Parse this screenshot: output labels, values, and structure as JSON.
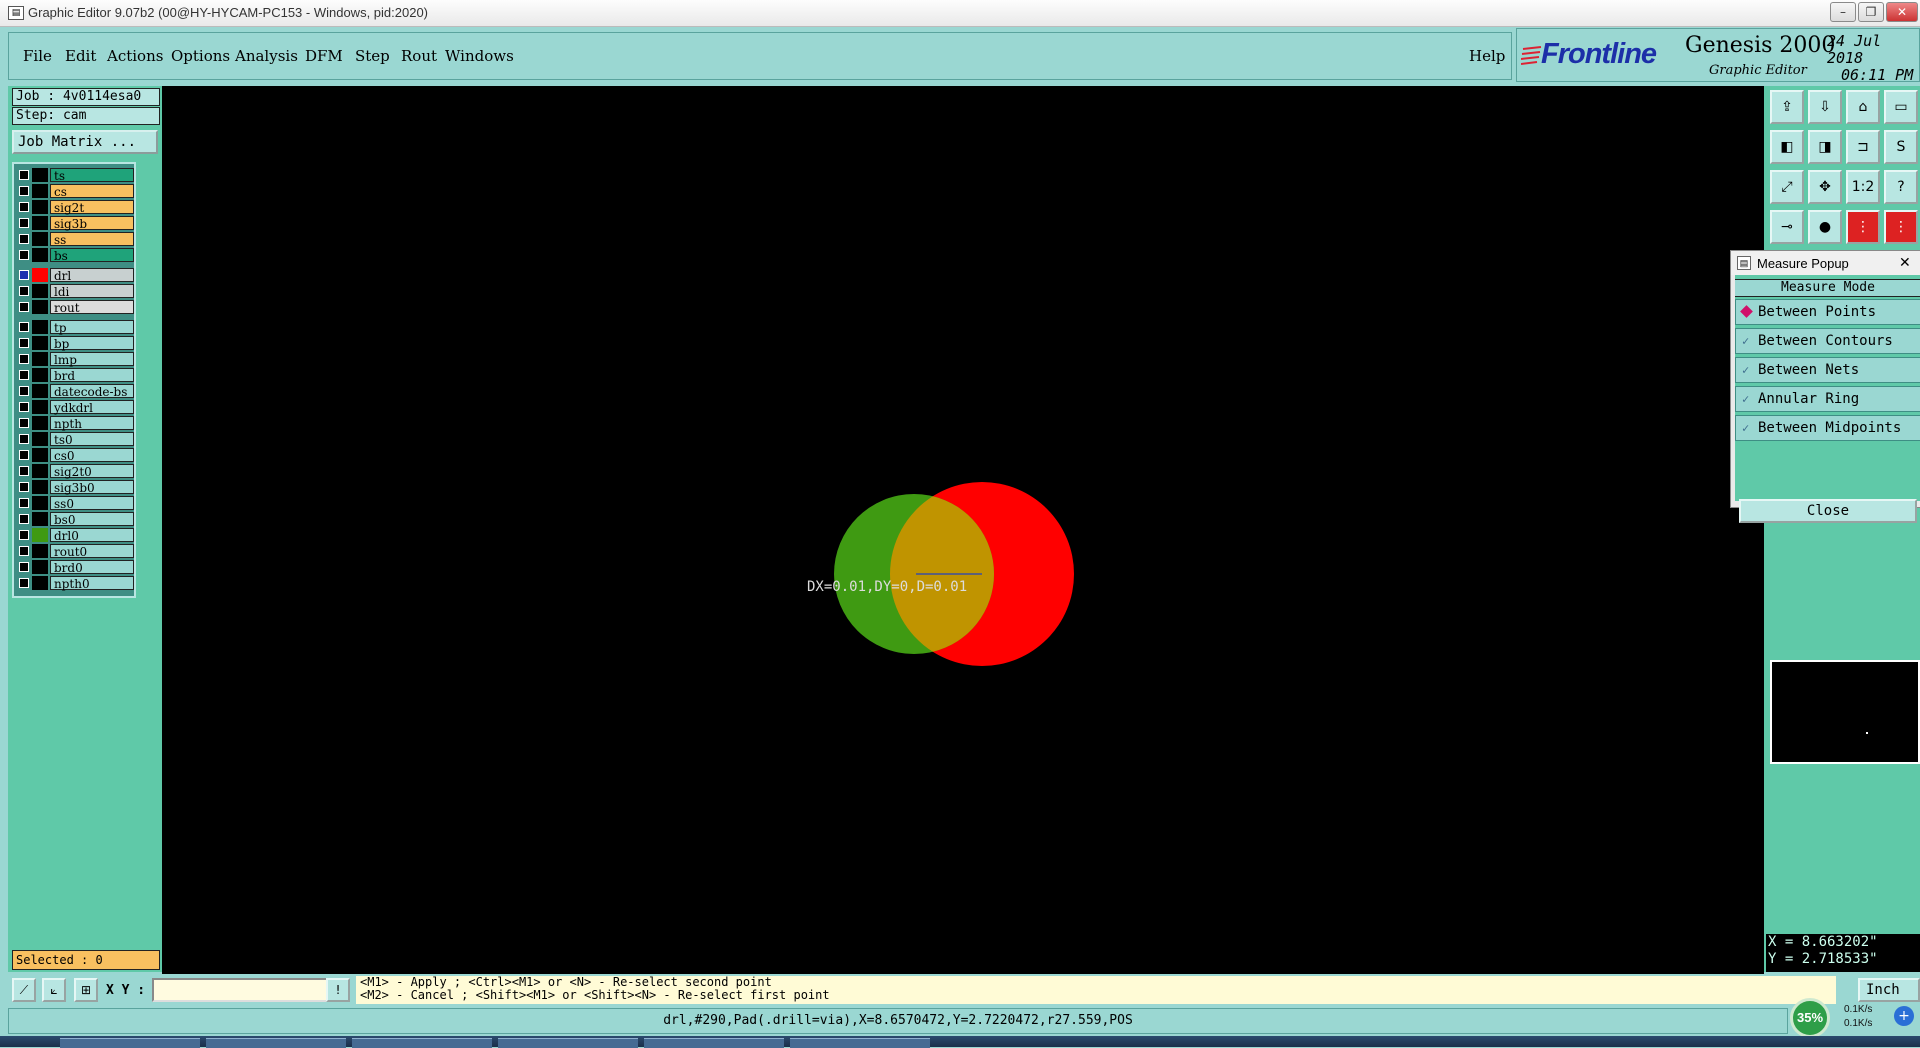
{
  "window": {
    "title": "Graphic Editor 9.07b2 (00@HY-HYCAM-PC153 - Windows, pid:2020)",
    "controls": [
      "–",
      "❐",
      "✕"
    ]
  },
  "menu": {
    "items": [
      {
        "label": "File",
        "name": "menu-file"
      },
      {
        "label": "Edit",
        "name": "menu-edit"
      },
      {
        "label": "Actions",
        "name": "menu-actions"
      },
      {
        "label": "Options",
        "name": "menu-options"
      },
      {
        "label": "Analysis",
        "name": "menu-analysis"
      },
      {
        "label": "DFM",
        "name": "menu-dfm"
      },
      {
        "label": "Step",
        "name": "menu-step"
      },
      {
        "label": "Rout",
        "name": "menu-rout"
      },
      {
        "label": "Windows",
        "name": "menu-windows"
      }
    ],
    "help": "Help"
  },
  "brand": {
    "logo": "Frontline",
    "product": "Genesis 2000",
    "subtitle": "Graphic Editor",
    "date": "24 Jul 2018",
    "time": "06:11 PM"
  },
  "job": {
    "job_label": "Job : 4v0114esa0",
    "step_label": "Step: cam",
    "matrix_button": "Job Matrix ..."
  },
  "layers": [
    {
      "name": "ts",
      "color": "#1fa37a",
      "swatch": "#000",
      "group": 0
    },
    {
      "name": "cs",
      "color": "#f8c060",
      "swatch": "#000",
      "group": 0
    },
    {
      "name": "sig2t",
      "color": "#f8c060",
      "swatch": "#000",
      "group": 0
    },
    {
      "name": "sig3b",
      "color": "#f8c060",
      "swatch": "#000",
      "group": 0
    },
    {
      "name": "ss",
      "color": "#f8c060",
      "swatch": "#000",
      "group": 0
    },
    {
      "name": "bs",
      "color": "#1fa37a",
      "swatch": "#000",
      "group": 0
    },
    {
      "name": "drl",
      "color": "#c8d0d0",
      "swatch": "#ff0000",
      "group": 1,
      "active": true
    },
    {
      "name": "ldi",
      "color": "#c8d0d0",
      "swatch": "#000",
      "group": 1
    },
    {
      "name": "rout",
      "color": "#dcdcdc",
      "swatch": "#000",
      "group": 1
    },
    {
      "name": "tp",
      "color": "#9ad7d2",
      "swatch": "#000",
      "group": 2
    },
    {
      "name": "bp",
      "color": "#9ad7d2",
      "swatch": "#000",
      "group": 2
    },
    {
      "name": "lmp",
      "color": "#9ad7d2",
      "swatch": "#000",
      "group": 2
    },
    {
      "name": "brd",
      "color": "#9ad7d2",
      "swatch": "#000",
      "group": 2
    },
    {
      "name": "datecode-bs",
      "color": "#9ad7d2",
      "swatch": "#000",
      "group": 2
    },
    {
      "name": "ydkdrl",
      "color": "#9ad7d2",
      "swatch": "#000",
      "group": 2
    },
    {
      "name": "npth",
      "color": "#9ad7d2",
      "swatch": "#000",
      "group": 2
    },
    {
      "name": "ts0",
      "color": "#9ad7d2",
      "swatch": "#000",
      "group": 2
    },
    {
      "name": "cs0",
      "color": "#9ad7d2",
      "swatch": "#000",
      "group": 2
    },
    {
      "name": "sig2t0",
      "color": "#9ad7d2",
      "swatch": "#000",
      "group": 2
    },
    {
      "name": "sig3b0",
      "color": "#9ad7d2",
      "swatch": "#000",
      "group": 2
    },
    {
      "name": "ss0",
      "color": "#9ad7d2",
      "swatch": "#000",
      "group": 2
    },
    {
      "name": "bs0",
      "color": "#9ad7d2",
      "swatch": "#000",
      "group": 2
    },
    {
      "name": "drl0",
      "color": "#9ad7d2",
      "swatch": "#3f9a12",
      "group": 2
    },
    {
      "name": "rout0",
      "color": "#9ad7d2",
      "swatch": "#000",
      "group": 2
    },
    {
      "name": "brd0",
      "color": "#9ad7d2",
      "swatch": "#000",
      "group": 2
    },
    {
      "name": "npth0",
      "color": "#9ad7d2",
      "swatch": "#000",
      "group": 2
    }
  ],
  "selected": "Selected : 0",
  "canvas": {
    "measurement": "DX=0.01,DY=0,D=0.01",
    "feature_colors": {
      "drl": "#ff0000",
      "drl0": "#3f9a12",
      "overlap": "#c09400"
    }
  },
  "toolbar": {
    "buttons": [
      {
        "name": "open-step-icon",
        "glyph": "⇪"
      },
      {
        "name": "save-step-icon",
        "glyph": "⇩"
      },
      {
        "name": "home-icon",
        "glyph": "⌂"
      },
      {
        "name": "window-icon",
        "glyph": "▭"
      },
      {
        "name": "undo-view-icon",
        "glyph": "◧"
      },
      {
        "name": "redo-view-icon",
        "glyph": "◨"
      },
      {
        "name": "snap-icon",
        "glyph": "⊐"
      },
      {
        "name": "route-icon",
        "glyph": "S"
      },
      {
        "name": "zoom-fit-icon",
        "glyph": "⤢"
      },
      {
        "name": "zoom-home-icon",
        "glyph": "✥"
      },
      {
        "name": "zoom-one-to-one-icon",
        "glyph": "1:2"
      },
      {
        "name": "help-icon",
        "glyph": "?"
      },
      {
        "name": "measure-ruler-icon",
        "glyph": "⊸"
      },
      {
        "name": "measure-point-icon",
        "glyph": "●"
      },
      {
        "name": "net-analyzer-icon",
        "glyph": "⋮"
      },
      {
        "name": "net-compare-icon",
        "glyph": "⋮"
      }
    ]
  },
  "measure_popup": {
    "title": "Measure Popup",
    "mode_heading": "Measure Mode",
    "options": [
      {
        "label": "Between Points",
        "selected": true
      },
      {
        "label": "Between Contours",
        "selected": false
      },
      {
        "label": "Between Nets",
        "selected": false
      },
      {
        "label": "Annular Ring",
        "selected": false
      },
      {
        "label": "Between Midpoints",
        "selected": false
      }
    ],
    "close": "Close"
  },
  "cursor": {
    "x": "X = 8.663202\"",
    "y": "Y = 2.718533\""
  },
  "bottom": {
    "xy_label": "X Y :",
    "xy_value": "",
    "hint_line1": "<M1> - Apply  ; <Ctrl><M1> or <N> - Re-select second point",
    "hint_line2": "<M2> - Cancel ; <Shift><M1> or <Shift><N> - Re-select first point",
    "units": "Inch",
    "status": "drl,#290,Pad(.drill=via),X=8.6570472,Y=2.7220472,r27.559,POS"
  },
  "netmon": {
    "percent": "35%",
    "up": "0.1K/s",
    "down": "0.1K/s"
  }
}
